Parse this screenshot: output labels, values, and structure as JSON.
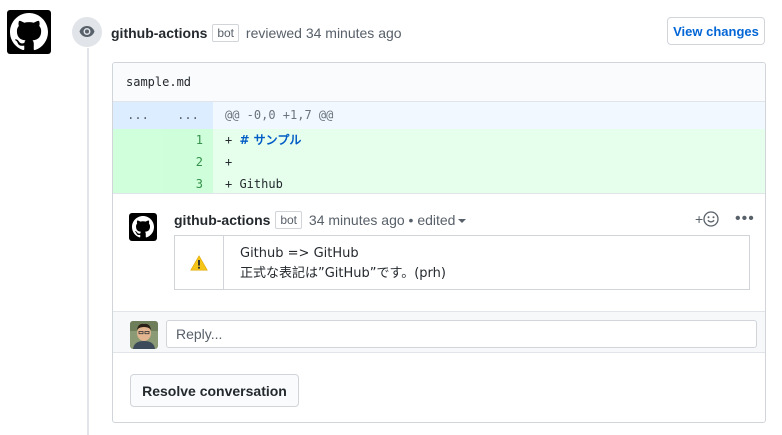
{
  "review": {
    "author": "github-actions",
    "bot_label": "bot",
    "action_text": "reviewed 34 minutes ago",
    "view_changes_label": "View changes"
  },
  "file": {
    "name": "sample.md",
    "hunk": {
      "left_num": "...",
      "right_num": "...",
      "header": "@@ -0,0 +1,7 @@"
    },
    "lines": [
      {
        "num": "1",
        "prefix": "+ ",
        "heading": "# サンプル",
        "text": ""
      },
      {
        "num": "2",
        "prefix": "+",
        "heading": "",
        "text": ""
      },
      {
        "num": "3",
        "prefix": "+ ",
        "heading": "",
        "text": "Github"
      }
    ]
  },
  "comment": {
    "author": "github-actions",
    "bot_label": "bot",
    "time": "34 minutes ago",
    "separator": "•",
    "edited": "edited",
    "react_plus": "+",
    "more": "•••",
    "line1": "Github => GitHub",
    "line2": "正式な表記は”GitHub”です。(prh)"
  },
  "reply": {
    "placeholder": "Reply..."
  },
  "resolve": {
    "label": "Resolve conversation"
  }
}
